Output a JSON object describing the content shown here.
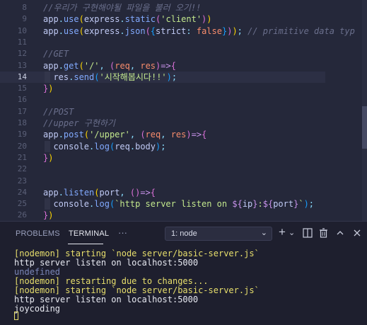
{
  "editor": {
    "lines": [
      {
        "n": "8",
        "tokens": [
          [
            "c-cm",
            "//우리가 구현해야될 파일을 불러 오기!!"
          ]
        ]
      },
      {
        "n": "9",
        "tokens": [
          [
            "c-var",
            "app"
          ],
          [
            "c-p",
            "."
          ],
          [
            "c-fn",
            "use"
          ],
          [
            "c-br1",
            "("
          ],
          [
            "c-var",
            "express"
          ],
          [
            "c-p",
            "."
          ],
          [
            "c-fn",
            "static"
          ],
          [
            "c-br2",
            "("
          ],
          [
            "c-str",
            "'client'"
          ],
          [
            "c-br2",
            ")"
          ],
          [
            "c-br1",
            ")"
          ]
        ]
      },
      {
        "n": "10",
        "tokens": [
          [
            "c-var",
            "app"
          ],
          [
            "c-p",
            "."
          ],
          [
            "c-fn",
            "use"
          ],
          [
            "c-br1",
            "("
          ],
          [
            "c-var",
            "express"
          ],
          [
            "c-p",
            "."
          ],
          [
            "c-fn",
            "json"
          ],
          [
            "c-br2",
            "("
          ],
          [
            "c-br3",
            "{"
          ],
          [
            "c-txt",
            "strict"
          ],
          [
            "c-p",
            ": "
          ],
          [
            "c-param",
            "false"
          ],
          [
            "c-br3",
            "}"
          ],
          [
            "c-br2",
            ")"
          ],
          [
            "c-br1",
            ")"
          ],
          [
            "c-p",
            "; "
          ],
          [
            "c-cm",
            "// primitive data typ"
          ]
        ]
      },
      {
        "n": "11",
        "tokens": []
      },
      {
        "n": "12",
        "tokens": [
          [
            "c-cm",
            "//GET"
          ]
        ]
      },
      {
        "n": "13",
        "tokens": [
          [
            "c-var",
            "app"
          ],
          [
            "c-p",
            "."
          ],
          [
            "c-fn",
            "get"
          ],
          [
            "c-br1",
            "("
          ],
          [
            "c-str",
            "'/'"
          ],
          [
            "c-p",
            ", "
          ],
          [
            "c-br2",
            "("
          ],
          [
            "c-param",
            "req"
          ],
          [
            "c-p",
            ", "
          ],
          [
            "c-param",
            "res"
          ],
          [
            "c-br2",
            ")"
          ],
          [
            "c-kw",
            "=>"
          ],
          [
            "c-br2",
            "{"
          ]
        ]
      },
      {
        "n": "14",
        "active": true,
        "tokens": [
          [
            "c-txt",
            "  res"
          ],
          [
            "c-p",
            "."
          ],
          [
            "c-fn",
            "send"
          ],
          [
            "c-br3",
            "("
          ],
          [
            "c-str",
            "'시작해봅시다!!'"
          ],
          [
            "c-br3",
            ")"
          ],
          [
            "c-p",
            ";"
          ]
        ]
      },
      {
        "n": "15",
        "tokens": [
          [
            "c-br2",
            "}"
          ],
          [
            "c-br1",
            ")"
          ]
        ]
      },
      {
        "n": "16",
        "tokens": []
      },
      {
        "n": "17",
        "tokens": [
          [
            "c-cm",
            "//POST"
          ]
        ]
      },
      {
        "n": "18",
        "tokens": [
          [
            "c-cm",
            "//upper 구현하기"
          ]
        ]
      },
      {
        "n": "19",
        "tokens": [
          [
            "c-var",
            "app"
          ],
          [
            "c-p",
            "."
          ],
          [
            "c-fn",
            "post"
          ],
          [
            "c-br1",
            "("
          ],
          [
            "c-str",
            "'/upper'"
          ],
          [
            "c-p",
            ", "
          ],
          [
            "c-br2",
            "("
          ],
          [
            "c-param",
            "req"
          ],
          [
            "c-p",
            ", "
          ],
          [
            "c-param",
            "res"
          ],
          [
            "c-br2",
            ")"
          ],
          [
            "c-kw",
            "=>"
          ],
          [
            "c-br2",
            "{"
          ]
        ]
      },
      {
        "n": "20",
        "guide": true,
        "tokens": [
          [
            "c-txt",
            "  console"
          ],
          [
            "c-p",
            "."
          ],
          [
            "c-fn",
            "log"
          ],
          [
            "c-br3",
            "("
          ],
          [
            "c-txt",
            "req"
          ],
          [
            "c-p",
            "."
          ],
          [
            "c-txt",
            "body"
          ],
          [
            "c-br3",
            ")"
          ],
          [
            "c-p",
            ";"
          ]
        ]
      },
      {
        "n": "21",
        "tokens": [
          [
            "c-br2",
            "}"
          ],
          [
            "c-br1",
            ")"
          ]
        ]
      },
      {
        "n": "22",
        "tokens": []
      },
      {
        "n": "23",
        "tokens": []
      },
      {
        "n": "24",
        "tokens": [
          [
            "c-var",
            "app"
          ],
          [
            "c-p",
            "."
          ],
          [
            "c-fn",
            "listen"
          ],
          [
            "c-br1",
            "("
          ],
          [
            "c-txt",
            "port"
          ],
          [
            "c-p",
            ", "
          ],
          [
            "c-br2",
            "("
          ],
          [
            "c-br2",
            ")"
          ],
          [
            "c-kw",
            "=>"
          ],
          [
            "c-br2",
            "{"
          ]
        ]
      },
      {
        "n": "25",
        "guide": true,
        "tokens": [
          [
            "c-txt",
            "  console"
          ],
          [
            "c-p",
            "."
          ],
          [
            "c-fn",
            "log"
          ],
          [
            "c-br3",
            "("
          ],
          [
            "c-str",
            "`http server listen on "
          ],
          [
            "c-kw",
            "${"
          ],
          [
            "c-txt",
            "ip"
          ],
          [
            "c-kw",
            "}"
          ],
          [
            "c-str",
            ":"
          ],
          [
            "c-kw",
            "${"
          ],
          [
            "c-txt",
            "port"
          ],
          [
            "c-kw",
            "}"
          ],
          [
            "c-str",
            "`"
          ],
          [
            "c-br3",
            ")"
          ],
          [
            "c-p",
            ";"
          ]
        ]
      },
      {
        "n": "26",
        "tokens": [
          [
            "c-br2",
            "}"
          ],
          [
            "c-br1",
            ")"
          ]
        ]
      }
    ]
  },
  "panel": {
    "tab_problems": "PROBLEMS",
    "tab_terminal": "TERMINAL",
    "more": "···",
    "terminal_select": "1: node",
    "icons": {
      "chevron": "⌄",
      "add": "+",
      "add_chevron": "⌄",
      "split": "▯",
      "trash": "🗑",
      "maximize": "︿",
      "close": "✕"
    }
  },
  "terminal": {
    "lines": [
      {
        "cls": "t-yellow",
        "text": "[nodemon] starting `node server/basic-server.js`"
      },
      {
        "cls": "t-white",
        "text": "http server listen on localhost:5000"
      },
      {
        "cls": "t-dim",
        "text": "undefined"
      },
      {
        "cls": "t-yellow",
        "text": "[nodemon] restarting due to changes..."
      },
      {
        "cls": "t-yellow",
        "text": "[nodemon] starting `node server/basic-server.js`"
      },
      {
        "cls": "t-white",
        "text": "http server listen on localhost:5000"
      },
      {
        "cls": "t-white",
        "text": "joycoding"
      }
    ]
  },
  "colors": {
    "editor_bg": "#25283a",
    "panel_bg": "#1e1f2e",
    "nodemon_yellow": "#e8df6c"
  }
}
